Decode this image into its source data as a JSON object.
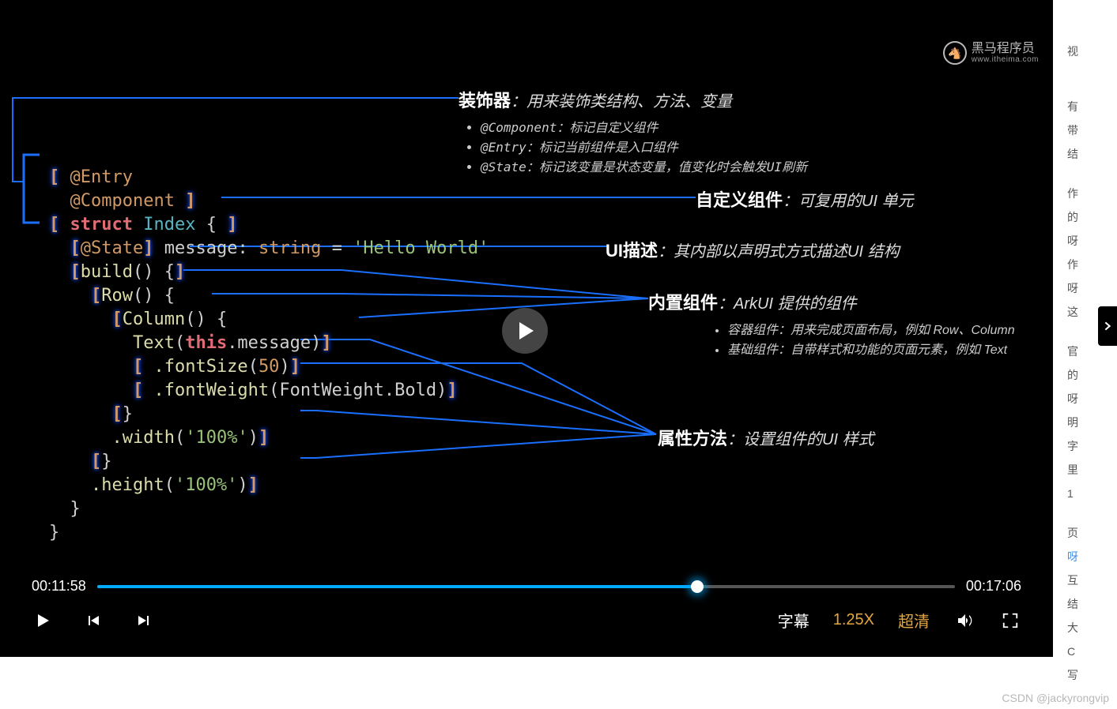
{
  "logo": {
    "text": "黑马程序员",
    "sub": "www.itheima.com",
    "icon": "🐴"
  },
  "code": {
    "entry": "@Entry",
    "component": "@Component",
    "struct": "struct",
    "structName": "Index",
    "state": "@State",
    "varName": "message",
    "varType": "string",
    "assign": "=",
    "strVal": "'Hello World'",
    "buildFn": "build",
    "row": "Row",
    "col": "Column",
    "text": "Text",
    "thisKw": "this",
    "msgProp": ".message",
    "fontSize": ".fontSize",
    "fontSizeArg": "50",
    "fontWeight": ".fontWeight",
    "fwEnum": "FontWeight",
    "fwVal": ".Bold",
    "width": ".width",
    "widthArg": "'100%'",
    "height": ".height",
    "heightArg": "'100%'"
  },
  "annotations": {
    "decorator": {
      "label": "装饰器",
      "desc": "：用来装饰类结构、方法、变量",
      "bullets": [
        "@Component：标记自定义组件",
        "@Entry：标记当前组件是入口组件",
        "@State：标记该变量是状态变量，值变化时会触发UI刷新"
      ]
    },
    "customComp": {
      "label": "自定义组件",
      "desc": "：可复用的UI 单元"
    },
    "uiDesc": {
      "label": "UI描述",
      "desc": "：其内部以声明式方式描述UI 结构"
    },
    "builtin": {
      "label": "内置组件",
      "desc": "：ArkUI 提供的组件",
      "bullets": [
        "容器组件：用来完成页面布局，例如 Row、Column",
        "基础组件：自带样式和功能的页面元素，例如 Text"
      ]
    },
    "attrMethod": {
      "label": "属性方法",
      "desc": "：设置组件的UI 样式"
    }
  },
  "player": {
    "currentTime": "00:11:58",
    "duration": "00:17:06",
    "subtitle": "字幕",
    "speed": "1.25X",
    "quality": "超清"
  },
  "side": {
    "items": [
      "视",
      "有",
      "带",
      "结",
      "",
      "作",
      "的",
      "呀",
      "作",
      "呀",
      "这",
      "",
      "官",
      "的",
      "呀",
      "明",
      "字",
      "里",
      "1",
      "",
      "页",
      "呀",
      "互",
      "结",
      "大",
      "C",
      "写"
    ]
  },
  "watermark": "CSDN @jackyrongvip"
}
